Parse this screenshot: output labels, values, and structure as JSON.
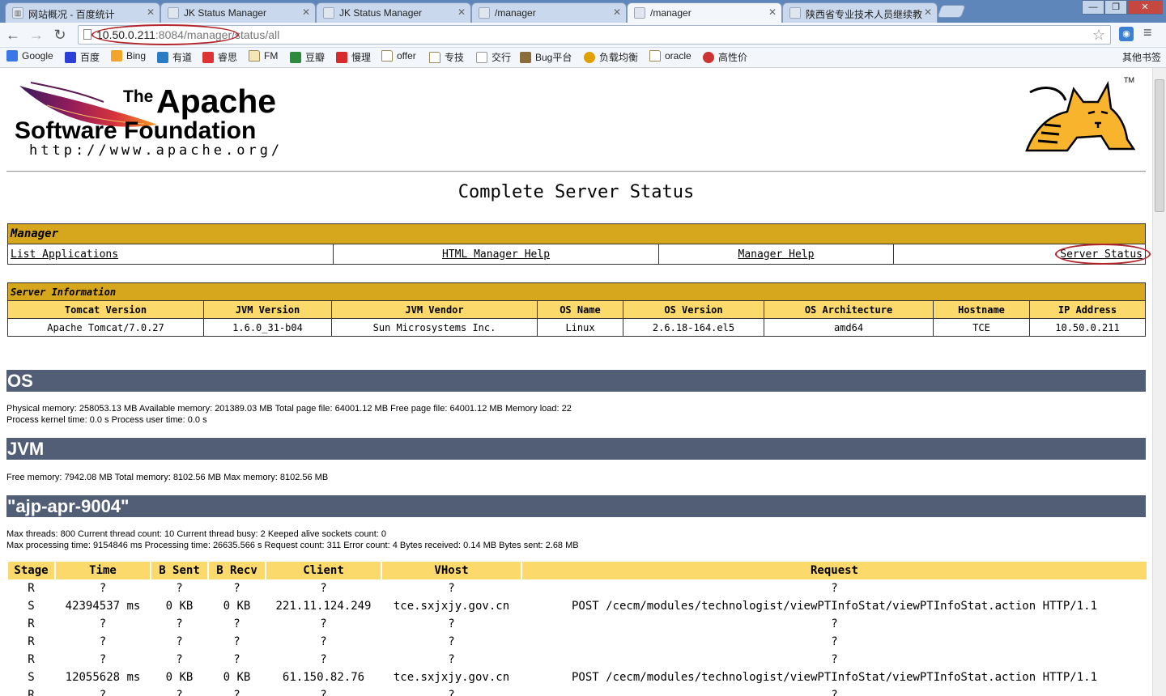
{
  "browser": {
    "tabs": [
      {
        "label": "网站概况 - 百度统计",
        "icon": "chart-favicon"
      },
      {
        "label": "JK Status Manager",
        "icon": "page-favicon"
      },
      {
        "label": "JK Status Manager",
        "icon": "page-favicon"
      },
      {
        "label": "/manager",
        "icon": "page-favicon"
      },
      {
        "label": "/manager",
        "icon": "page-favicon",
        "active": true
      },
      {
        "label": "陕西省专业技术人员继续教",
        "icon": "page-favicon"
      }
    ],
    "window_controls": {
      "minimize": "—",
      "maximize": "❐",
      "close": "✕"
    },
    "url_host": "10.50.0.211",
    "url_rest": ":8084/manager/status/all",
    "bookmarks": [
      "Google",
      "百度",
      "Bing",
      "有道",
      "睿思",
      "FM",
      "豆瓣",
      "慢理",
      "offer",
      "专技",
      "交行",
      "Bug平台",
      "负载均衡",
      "oracle",
      "高性价"
    ],
    "other_bookmarks": "其他书签"
  },
  "logo": {
    "the": "The",
    "apache": "Apache",
    "software_foundation": "Software Foundation",
    "url": "http://www.apache.org/",
    "tm": "TM"
  },
  "page_title": "Complete Server Status",
  "manager": {
    "header": "Manager",
    "links": [
      "List Applications",
      "HTML Manager Help",
      "Manager Help",
      "Server Status"
    ]
  },
  "server_info": {
    "header": "Server Information",
    "columns": [
      "Tomcat Version",
      "JVM Version",
      "JVM Vendor",
      "OS Name",
      "OS Version",
      "OS Architecture",
      "Hostname",
      "IP Address"
    ],
    "values": [
      "Apache Tomcat/7.0.27",
      "1.6.0_31-b04",
      "Sun Microsystems Inc.",
      "Linux",
      "2.6.18-164.el5",
      "amd64",
      "TCE",
      "10.50.0.211"
    ]
  },
  "os": {
    "title": "OS",
    "line1": "Physical memory: 258053.13 MB Available memory: 201389.03 MB Total page file: 64001.12 MB Free page file: 64001.12 MB Memory load: 22",
    "line2": "Process kernel time: 0.0 s Process user time: 0.0 s"
  },
  "jvm": {
    "title": "JVM",
    "line1": "Free memory: 7942.08 MB Total memory: 8102.56 MB Max memory: 8102.56 MB"
  },
  "connector": {
    "title": "\"ajp-apr-9004\"",
    "line1": "Max threads: 800 Current thread count: 10 Current thread busy: 2 Keeped alive sockets count: 0",
    "line2": "Max processing time: 9154846 ms Processing time: 26635.566 s Request count: 311 Error count: 4 Bytes received: 0.14 MB Bytes sent: 2.68 MB"
  },
  "requests": {
    "columns": [
      "Stage",
      "Time",
      "B Sent",
      "B Recv",
      "Client",
      "VHost",
      "Request"
    ],
    "rows": [
      [
        "R",
        "?",
        "?",
        "?",
        "?",
        "?",
        "?"
      ],
      [
        "S",
        "42394537 ms",
        "0 KB",
        "0 KB",
        "221.11.124.249",
        "tce.sxjxjy.gov.cn",
        "POST /cecm/modules/technologist/viewPTInfoStat/viewPTInfoStat.action HTTP/1.1"
      ],
      [
        "R",
        "?",
        "?",
        "?",
        "?",
        "?",
        "?"
      ],
      [
        "R",
        "?",
        "?",
        "?",
        "?",
        "?",
        "?"
      ],
      [
        "R",
        "?",
        "?",
        "?",
        "?",
        "?",
        "?"
      ],
      [
        "S",
        "12055628 ms",
        "0 KB",
        "0 KB",
        "61.150.82.76",
        "tce.sxjxjy.gov.cn",
        "POST /cecm/modules/technologist/viewPTInfoStat/viewPTInfoStat.action HTTP/1.1"
      ],
      [
        "R",
        "?",
        "?",
        "?",
        "?",
        "?",
        "?"
      ]
    ]
  },
  "colors": {
    "section_bg": "#525d76",
    "gold": "#d6a61c",
    "gold_light": "#fbd96b",
    "annotation": "#b3262d"
  }
}
